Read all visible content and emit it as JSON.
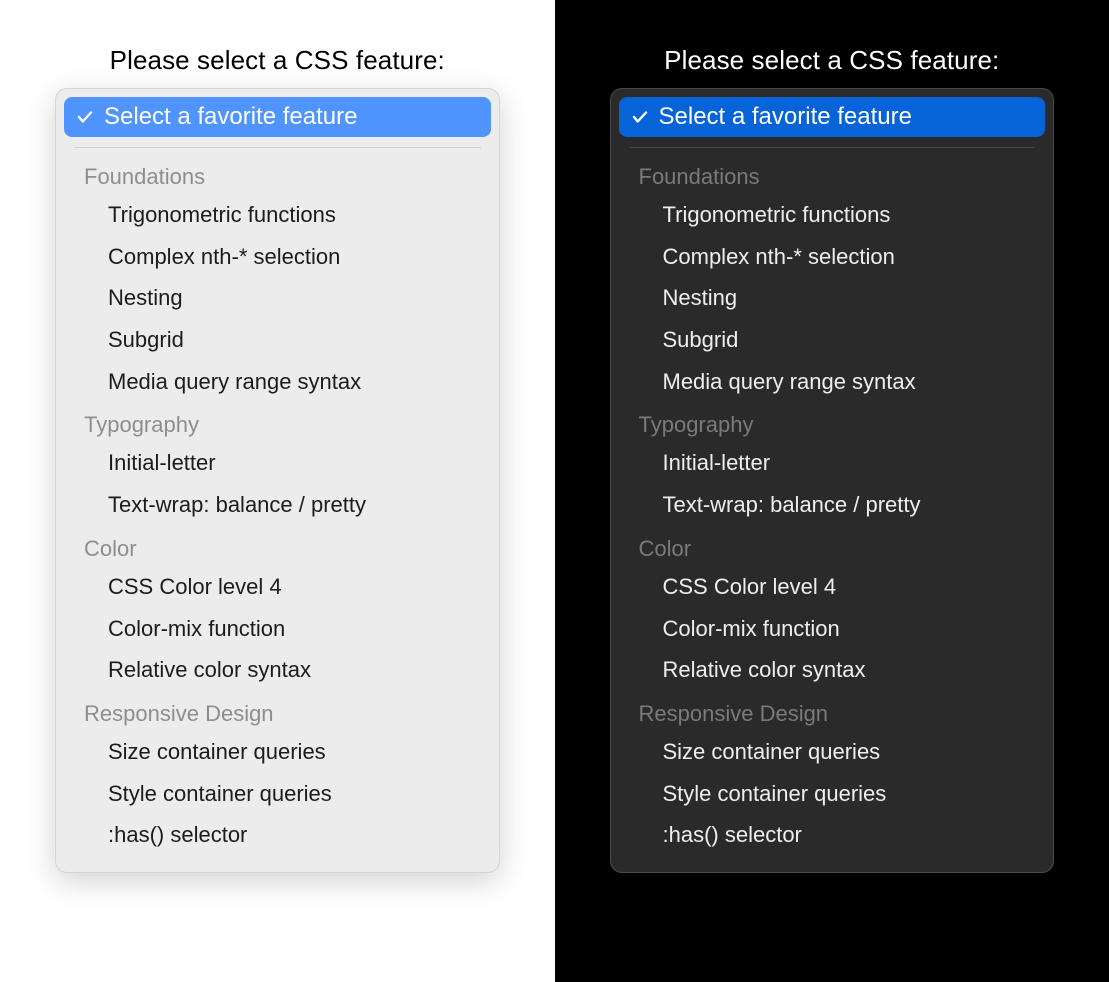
{
  "prompt_label": "Please select a CSS feature:",
  "selected_label": "Select a favorite feature",
  "colors": {
    "light_accent": "#4f94ff",
    "dark_accent": "#0763d8"
  },
  "groups": [
    {
      "label": "Foundations",
      "options": [
        "Trigonometric functions",
        "Complex nth-* selection",
        "Nesting",
        "Subgrid",
        "Media query range syntax"
      ]
    },
    {
      "label": "Typography",
      "options": [
        "Initial-letter",
        "Text-wrap: balance / pretty"
      ]
    },
    {
      "label": "Color",
      "options": [
        "CSS Color level 4",
        "Color-mix function",
        "Relative color syntax"
      ]
    },
    {
      "label": "Responsive Design",
      "options": [
        "Size container queries",
        "Style container queries",
        ":has() selector"
      ]
    }
  ]
}
